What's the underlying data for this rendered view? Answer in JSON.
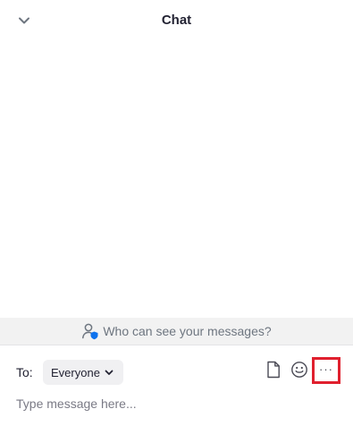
{
  "header": {
    "title": "Chat",
    "collapse_icon": "chevron-down-icon"
  },
  "visibility": {
    "text": "Who can see your messages?",
    "icon": "user-shield-icon",
    "icon_accent": "#0e72ed"
  },
  "composer": {
    "to_label": "To:",
    "recipient": "Everyone",
    "placeholder": "Type message here...",
    "value": "",
    "tools": [
      "file-icon",
      "emoji-icon",
      "more-icon"
    ],
    "more_label": "···",
    "highlight_color": "#e0202e"
  }
}
